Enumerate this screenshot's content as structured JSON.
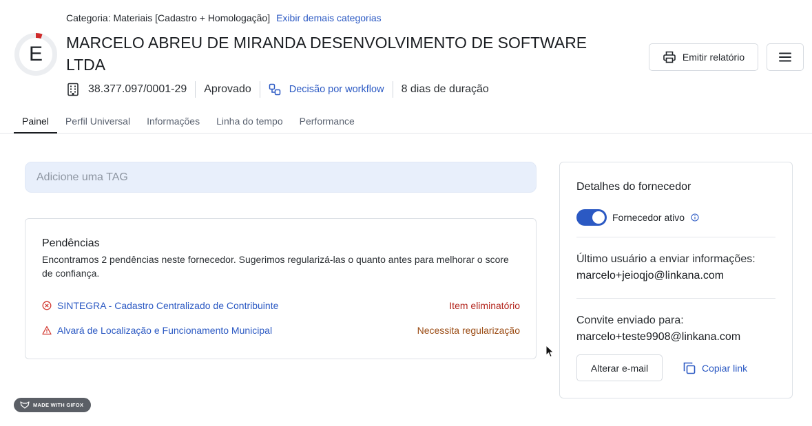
{
  "header": {
    "score_letter": "E",
    "category_text": "Categoria: Materiais [Cadastro + Homologação]",
    "category_link": "Exibir demais categorias",
    "title": "MARCELO ABREU DE MIRANDA DESENVOLVIMENTO DE SOFTWARE LTDA",
    "cnpj": "38.377.097/0001-29",
    "status": "Aprovado",
    "workflow": "Decisão por workflow",
    "duration": "8 dias de duração",
    "report_button": "Emitir relatório"
  },
  "tabs": [
    {
      "label": "Painel",
      "active": true
    },
    {
      "label": "Perfil Universal",
      "active": false
    },
    {
      "label": "Informações",
      "active": false
    },
    {
      "label": "Linha do tempo",
      "active": false
    },
    {
      "label": "Performance",
      "active": false
    }
  ],
  "tag": {
    "placeholder": "Adicione uma TAG"
  },
  "pendencias": {
    "title": "Pendências",
    "description": "Encontramos 2 pendências neste fornecedor. Sugerimos regularizá-las o quanto antes para melhorar o score de confiança.",
    "items": [
      {
        "label": "SINTEGRA - Cadastro Centralizado de Contribuinte",
        "status": "Item eliminatório",
        "icon": "x-circle-icon",
        "color": "#b3261e"
      },
      {
        "label": "Alvará de Localização e Funcionamento Municipal",
        "status": "Necessita regularização",
        "icon": "warning-triangle-icon",
        "color": "#9a4a12"
      }
    ]
  },
  "detalhes": {
    "title": "Detalhes do fornecedor",
    "active_label": "Fornecedor ativo",
    "last_user_label": "Último usuário a enviar informações:",
    "last_user_email": "marcelo+jeioqjo@linkana.com",
    "invite_label": "Convite enviado para:",
    "invite_email": "marcelo+teste9908@linkana.com",
    "change_email_button": "Alterar e-mail",
    "copy_link": "Copiar link"
  },
  "watermark": "MADE WITH GIFOX",
  "colors": {
    "accent": "#2b59c3",
    "score_ring": "#cf2a2a",
    "error": "#b3261e",
    "warning": "#9a4a12"
  }
}
